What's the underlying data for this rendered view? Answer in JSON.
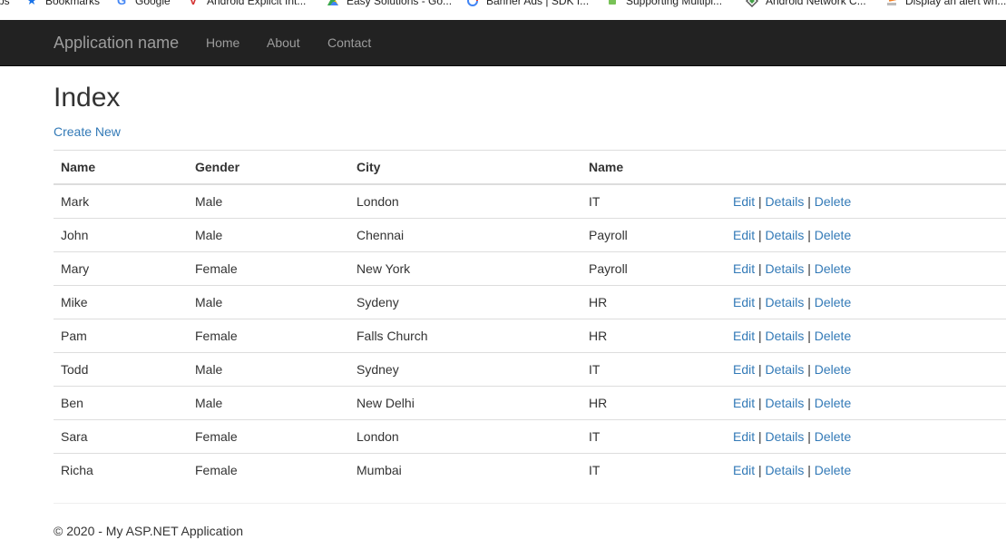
{
  "bookmarks": [
    {
      "label": "ps",
      "icon": "apps-icon"
    },
    {
      "label": "Bookmarks",
      "icon": "star-icon"
    },
    {
      "label": "Google",
      "icon": "google-icon"
    },
    {
      "label": "Android Explicit Int...",
      "icon": "v-icon"
    },
    {
      "label": "Easy Solutions - Go...",
      "icon": "drive-icon"
    },
    {
      "label": "Banner Ads  |  SDK f...",
      "icon": "admob-icon"
    },
    {
      "label": "Supporting Multipl...",
      "icon": "android-icon"
    },
    {
      "label": "Android Network C...",
      "icon": "diamond-icon"
    },
    {
      "label": "Display an alert wh...",
      "icon": "stack-icon"
    }
  ],
  "navbar": {
    "brand": "Application name",
    "links": [
      "Home",
      "About",
      "Contact"
    ]
  },
  "page": {
    "title": "Index",
    "create_link": "Create New"
  },
  "table": {
    "headers": [
      "Name",
      "Gender",
      "City",
      "Name"
    ],
    "action_labels": {
      "edit": "Edit",
      "details": "Details",
      "delete": "Delete",
      "separator": "|"
    },
    "rows": [
      [
        "Mark",
        "Male",
        "London",
        "IT"
      ],
      [
        "John",
        "Male",
        "Chennai",
        "Payroll"
      ],
      [
        "Mary",
        "Female",
        "New York",
        "Payroll"
      ],
      [
        "Mike",
        "Male",
        "Sydeny",
        "HR"
      ],
      [
        "Pam",
        "Female",
        "Falls Church",
        "HR"
      ],
      [
        "Todd",
        "Male",
        "Sydney",
        "IT"
      ],
      [
        "Ben",
        "Male",
        "New Delhi",
        "HR"
      ],
      [
        "Sara",
        "Female",
        "London",
        "IT"
      ],
      [
        "Richa",
        "Female",
        "Mumbai",
        "IT"
      ]
    ]
  },
  "footer": {
    "text": "© 2020 - My ASP.NET Application"
  },
  "colors": {
    "navbar_bg": "#222222",
    "navbar_text": "#9d9d9d",
    "link": "#337ab7",
    "text": "#333333",
    "border": "#dddddd"
  }
}
